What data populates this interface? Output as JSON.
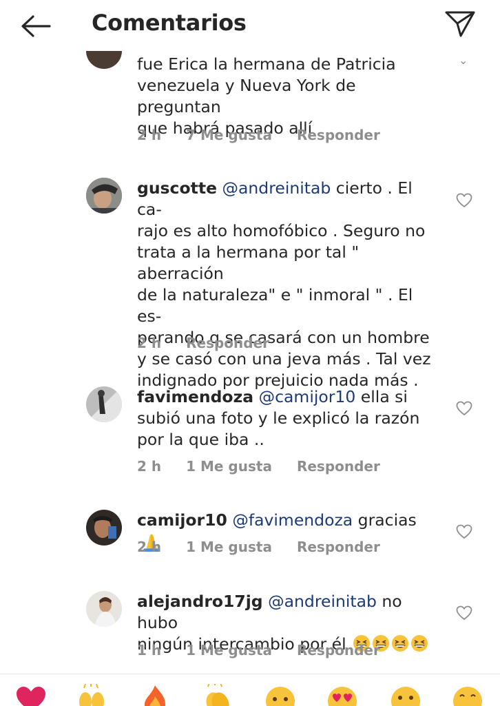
{
  "header": {
    "title": "Comentarios"
  },
  "comments": [
    {
      "username": "",
      "text": "fue Erica la hermana de Patricia venezuela y Nueva York de preguntan que habrá pasado allí",
      "time": "2 h",
      "likes": "7 Me gusta",
      "reply": "Responder"
    },
    {
      "username": "guscotte",
      "mention": "@andreinitab",
      "line1": " cierto . El ca-",
      "lines": [
        "rajo es alto homofóbico . Seguro no",
        "trata a la hermana por tal \" aberración",
        "de la naturaleza\" e \" inmoral \" . El es-",
        "perando q se casará con un hombre",
        "y se casó con una jeva más . Tal vez",
        "indignado por prejuicio nada más ."
      ],
      "time": "2 h",
      "reply": "Responder"
    },
    {
      "username": "favimendoza",
      "mention": "@camijor10",
      "line1": " ella si",
      "lines": [
        "subió una foto y le explicó la razón",
        "por la que iba .."
      ],
      "time": "2 h",
      "likes": "1 Me gusta",
      "reply": "Responder"
    },
    {
      "username": "camijor10",
      "mention": "@favimendoza",
      "line1": " gracias",
      "emoji": "folded-hands",
      "time": "2 h",
      "likes": "1 Me gusta",
      "reply": "Responder"
    },
    {
      "username": "alejandro17jg",
      "mention": "@andreinitab",
      "line1": " no hubo",
      "line2": "ningún intercambio por él",
      "emoji": "grinning-squint-face x4",
      "time": "1 h",
      "likes": "1 Me gusta",
      "reply": "Responder"
    }
  ],
  "first_comment_lines": [
    "fue Erica la hermana de Patricia",
    "venezuela y Nueva York de preguntan",
    "que habrá pasado allí"
  ],
  "emoji_bar": [
    "red-heart",
    "raising-hands",
    "fire",
    "clapping-hands",
    "crying-face",
    "heart-eyes-face",
    "astonished-face",
    "grinning-face"
  ],
  "colors": {
    "mention": "#1c3a7a",
    "meta": "#8e8e8e",
    "text": "#262626"
  }
}
